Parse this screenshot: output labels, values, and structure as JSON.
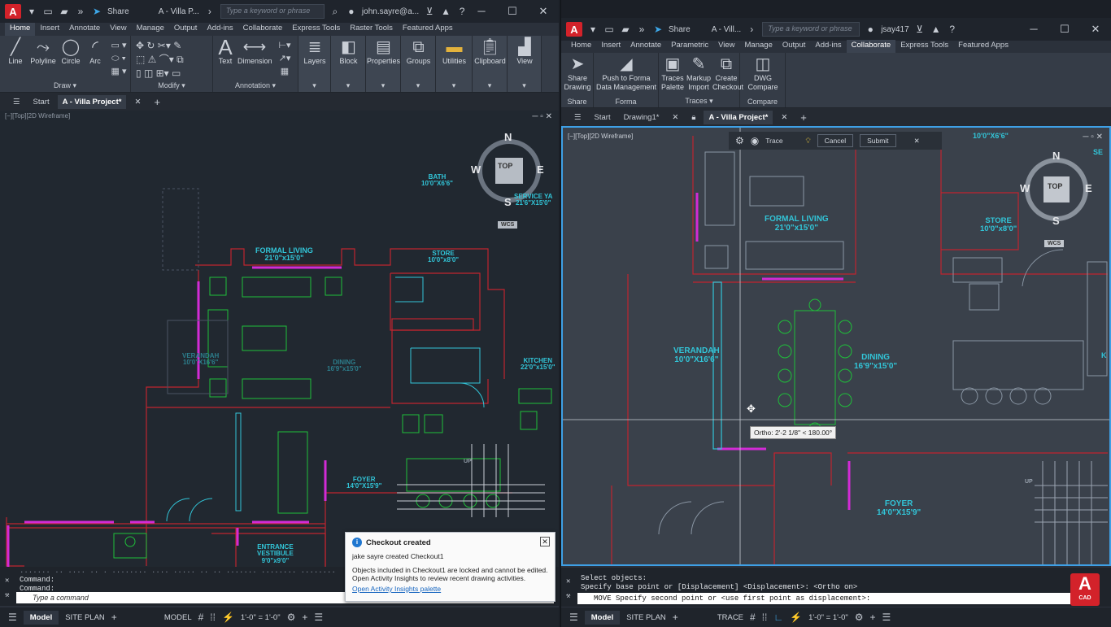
{
  "left": {
    "title_text": "A - Villa P...",
    "share": "Share",
    "search_placeholder": "Type a keyword or phrase",
    "user": "john.sayre@a...",
    "ribbon_tabs": [
      "Home",
      "Insert",
      "Annotate",
      "View",
      "Manage",
      "Output",
      "Add-ins",
      "Collaborate",
      "Express Tools",
      "Raster Tools",
      "Featured Apps"
    ],
    "tools": {
      "line": "Line",
      "polyline": "Polyline",
      "circle": "Circle",
      "arc": "Arc",
      "text": "Text",
      "dimension": "Dimension",
      "layers": "Layers",
      "block": "Block",
      "properties": "Properties",
      "groups": "Groups",
      "utilities": "Utilities",
      "clipboard": "Clipboard",
      "view": "View"
    },
    "groups": {
      "draw": "Draw ▾",
      "modify": "Modify ▾",
      "annotation": "Annotation ▾"
    },
    "doc_tabs": {
      "start": "Start",
      "active": "A - Villa Project*"
    },
    "viewport_label": "[−][Top][2D Wireframe]",
    "rooms": {
      "bath": "BATH\n10'0\"X6'6\"",
      "service": "SERVICE YA\n21'6\"X15'0\"",
      "formal_living": "FORMAL LIVING\n21'0\"x15'0\"",
      "store": "STORE\n10'0\"x8'0\"",
      "verandah": "VERANDAH\n10'0\"X16'6\"",
      "dining": "DINING\n16'9\"x15'0\"",
      "kitchen": "KITCHEN\n22'0\"x15'0\"",
      "foyer": "FOYER\n14'0\"X15'9\"",
      "entrance": "ENTRANCE\nVESTIBULE\n9'0\"x9'0\""
    },
    "viewcube": {
      "n": "N",
      "s": "S",
      "e": "E",
      "w": "W",
      "top": "TOP",
      "wcs": "WCS"
    },
    "up_label": "UP",
    "command_lines": [
      "Command:",
      "Command:"
    ],
    "command_history": "....... .. .... .. . ........ .... ..... .. .. ....... ........ ........",
    "command_placeholder": "Type a command",
    "status": {
      "model_tab": "Model",
      "layout_tab": "SITE PLAN",
      "model": "MODEL",
      "scale": "1'-0\" = 1'-0\""
    },
    "notification": {
      "title": "Checkout created",
      "line1": "jake sayre created Checkout1",
      "line2": "Objects included in Checkout1 are locked and cannot be edited. Open Activity Insights to review recent drawing activities.",
      "link": "Open Activity Insights palette"
    }
  },
  "right": {
    "title_text": "A - Vill...",
    "share": "Share",
    "search_placeholder": "Type a keyword or phrase",
    "user": "jsay417",
    "ribbon_tabs": [
      "Home",
      "Insert",
      "Annotate",
      "Parametric",
      "View",
      "Manage",
      "Output",
      "Add-ins",
      "Collaborate",
      "Express Tools",
      "Featured Apps"
    ],
    "tools": {
      "share_drawing": "Share\nDrawing",
      "push": "Push to Forma\nData Management",
      "traces": "Traces\nPalette",
      "markup": "Markup\nImport",
      "checkout": "Create\nCheckout",
      "dwg_compare": "DWG\nCompare"
    },
    "groups": {
      "share": "Share",
      "forma": "Forma",
      "traces": "Traces ▾",
      "compare": "Compare"
    },
    "doc_tabs": {
      "start": "Start",
      "drawing1": "Drawing1*",
      "active": "A - Villa Project*"
    },
    "viewport_label": "[−][Top][2D Wireframe]",
    "trace_bar": {
      "label": "Trace",
      "cancel": "Cancel",
      "submit": "Submit"
    },
    "rooms": {
      "room_top": "10'0\"X6'6\"",
      "formal_living": "FORMAL LIVING\n21'0\"x15'0\"",
      "store": "STORE\n10'0\"x8'0\"",
      "verandah": "VERANDAH\n10'0\"X16'6\"",
      "dining": "DINING\n16'9\"x15'0\"",
      "foyer": "FOYER\n14'0\"X15'9\"",
      "se": "SE",
      "k": "K"
    },
    "viewcube": {
      "n": "N",
      "s": "S",
      "e": "E",
      "w": "W",
      "top": "TOP",
      "wcs": "WCS"
    },
    "up_label": "UP",
    "ortho_tip": "Ortho: 2'-2 1/8\" < 180.00°",
    "command_lines": [
      "Select objects:",
      "Specify base point or [Displacement] <Displacement>:  <Ortho on>"
    ],
    "command_prompt": "MOVE Specify second point or <use first point as displacement>:",
    "status": {
      "model_tab": "Model",
      "layout_tab": "SITE PLAN",
      "model": "TRACE",
      "scale": "1'-0\" = 1'-0\""
    },
    "badge": {
      "letter": "A",
      "sub": "CAD"
    }
  },
  "colors": {
    "wall": "#c0242f",
    "furniture": "#1fbf3a",
    "label": "#32c5d8",
    "accent": "#d22bd6",
    "selection": "#3ea0e6"
  }
}
